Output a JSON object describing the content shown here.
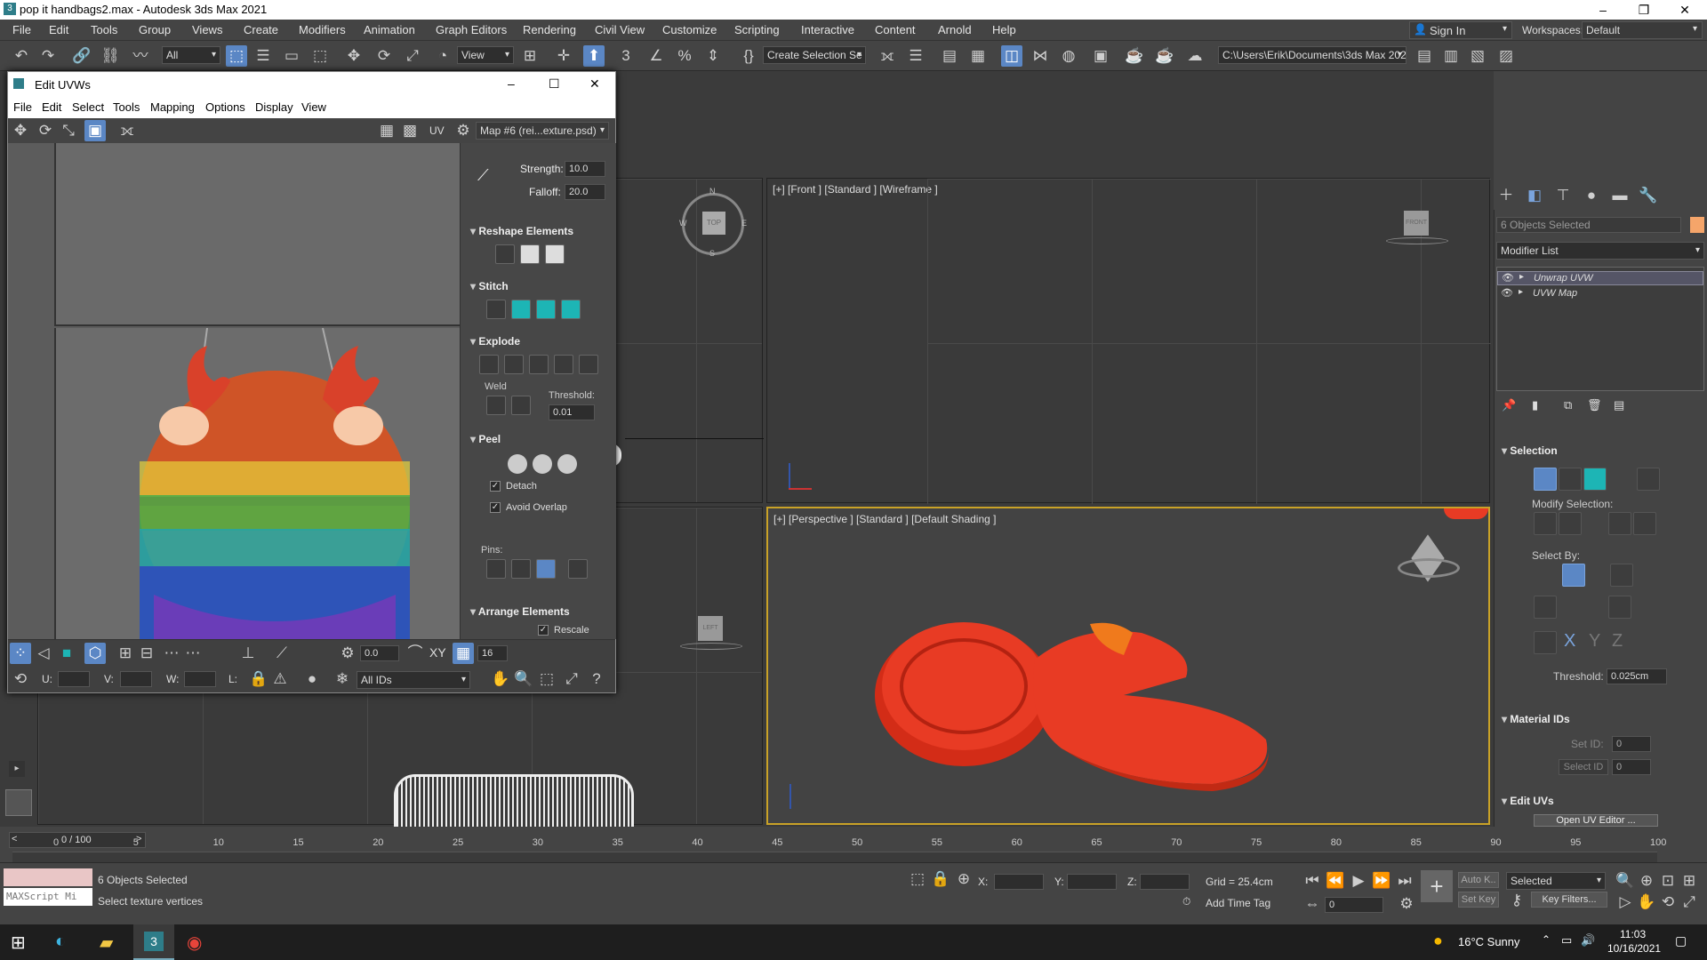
{
  "app": {
    "title": "pop it handbags2.max - Autodesk 3ds Max 2021"
  },
  "menu": [
    "File",
    "Edit",
    "Tools",
    "Group",
    "Views",
    "Create",
    "Modifiers",
    "Animation",
    "Graph Editors",
    "Rendering",
    "Civil View",
    "Customize",
    "Scripting",
    "Interactive",
    "Content",
    "Arnold",
    "Help"
  ],
  "signin": "Sign In",
  "workspaces_label": "Workspaces:",
  "workspace": "Default",
  "toolbar": {
    "filter": "All",
    "view": "View",
    "selection_set": "Create Selection Se",
    "path": "C:\\Users\\Erik\\Documents\\3ds Max 2021"
  },
  "viewports": {
    "front_label": "[+] [Front ] [Standard ] [Wireframe ]",
    "persp_label": "[+] [Perspective ] [Standard ] [Default Shading ]",
    "compass": {
      "n": "N",
      "e": "E",
      "s": "S",
      "w": "W",
      "top": "TOP"
    },
    "left_cube": "LEFT",
    "front_cube": "FRONT"
  },
  "uvw": {
    "title": "Edit UVWs",
    "menu": [
      "File",
      "Edit",
      "Select",
      "Tools",
      "Mapping",
      "Options",
      "Display",
      "View"
    ],
    "uv_label": "UV",
    "map_select": "Map #6 (rei...exture.psd)",
    "strength_label": "Strength:",
    "strength": "10.0",
    "falloff_label": "Falloff:",
    "falloff": "20.0",
    "reshape": "Reshape Elements",
    "stitch": "Stitch",
    "explode": "Explode",
    "weld": "Weld",
    "threshold_label": "Threshold:",
    "threshold": "0.01",
    "peel": "Peel",
    "detach": "Detach",
    "avoid_overlap": "Avoid Overlap",
    "pins": "Pins:",
    "arrange": "Arrange Elements",
    "rescale": "Rescale",
    "rot_value": "0.0",
    "xy": "XY",
    "grid_value": "16",
    "u_label": "U:",
    "v_label": "V:",
    "w_label": "W:",
    "l_label": "L:",
    "ids": "All IDs"
  },
  "cmd": {
    "selected": "6 Objects Selected",
    "modifier_list": "Modifier List",
    "stack": [
      "Unwrap UVW",
      "UVW Map"
    ],
    "selection": "Selection",
    "modify_selection": "Modify Selection:",
    "select_by": "Select By:",
    "threshold_label": "Threshold:",
    "threshold": "0.025cm",
    "material_ids": "Material IDs",
    "set_id": "Set ID:",
    "set_id_value": "0",
    "select_id": "Select ID",
    "select_id_value": "0",
    "edit_uvs": "Edit UVs",
    "open_uv_editor": "Open UV Editor ..."
  },
  "timeline": {
    "frame": "0 / 100",
    "ticks": [
      "0",
      "5",
      "10",
      "15",
      "20",
      "25",
      "30",
      "35",
      "40",
      "45",
      "50",
      "55",
      "60",
      "65",
      "70",
      "75",
      "80",
      "85",
      "90",
      "95",
      "100"
    ]
  },
  "status": {
    "objects": "6 Objects Selected",
    "prompt": "Select texture vertices",
    "maxscript": "MAXScript Mi",
    "x": "X:",
    "y": "Y:",
    "z": "Z:",
    "grid": "Grid = 25.4cm",
    "add_time_tag": "Add Time Tag",
    "autokey": "Auto K..",
    "setkey": "Set Key",
    "selected": "Selected",
    "keyfilters": "Key Filters...",
    "frame_field": "0"
  },
  "taskbar": {
    "weather": "16°C  Sunny",
    "time": "11:03",
    "date": "10/16/2021"
  },
  "colors": {
    "accent": "#5b87c5",
    "object": "#e83b24",
    "teal": "#1db5b5",
    "swatch": "#f5a56a"
  }
}
